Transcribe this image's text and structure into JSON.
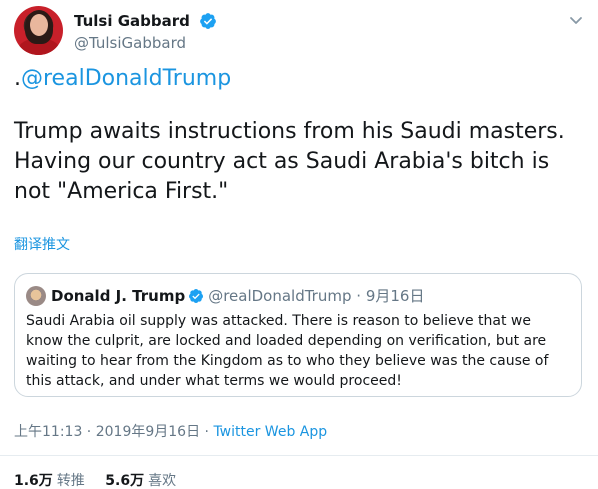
{
  "author": {
    "display_name": "Tulsi Gabbard",
    "handle": "@TulsiGabbard"
  },
  "tweet": {
    "mention": "@realDonaldTrump",
    "mention_prefix": ".",
    "lines": [
      "Trump awaits instructions from his Saudi masters.",
      "Having our country act as Saudi Arabia's bitch is",
      "not \"America First.\""
    ]
  },
  "translate_link": "翻译推文",
  "quoted": {
    "display_name": "Donald J. Trump",
    "handle": "@realDonaldTrump",
    "separator": "·",
    "date": "9月16日",
    "lines": [
      "Saudi Arabia oil supply was attacked. There is reason to believe that we",
      "know the culprit, are locked and loaded depending on verification, but are",
      "waiting to hear from the Kingdom as to who they believe was the cause of",
      "this attack, and under what terms we would proceed!"
    ]
  },
  "meta": {
    "time": "上午11:13",
    "separator1": " · ",
    "date": "2019年9月16日",
    "separator2": " · ",
    "source": "Twitter Web App"
  },
  "stats": {
    "retweets_count": "1.6万",
    "retweets_label": "转推",
    "likes_count": "5.6万",
    "likes_label": "喜欢"
  },
  "colors": {
    "link_blue": "#1b95e0",
    "verified_blue": "#1da1f2",
    "secondary_text": "#657786",
    "border": "#ccd6dd"
  },
  "icons": {
    "verified": "verified-badge-icon",
    "caret": "chevron-down-icon"
  }
}
